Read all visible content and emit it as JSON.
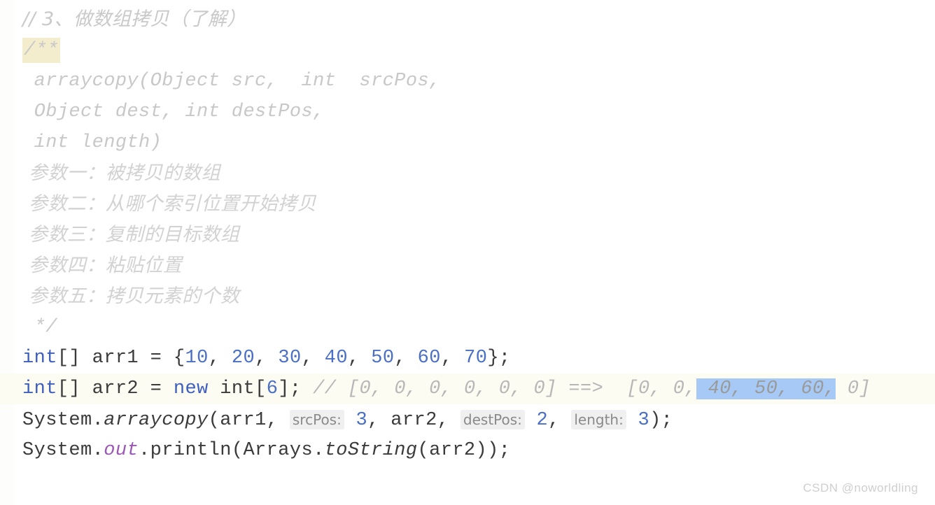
{
  "editor": {
    "background_color": "#ffffff",
    "current_line_color": "#fdfcf3",
    "selection_color": "#a6caf5",
    "find_highlight_color": "#f3eccd",
    "keyword_color": "#3f5fbf",
    "number_color": "#4a6fc4",
    "comment_color": "#c9c9c9",
    "static_field_color": "#9b59b6",
    "hint_background_color": "#f0f0f0"
  },
  "lines": {
    "l1": {
      "comment": "// 3、做数组拷贝（了解）"
    },
    "l2": {
      "javadoc_open": "/**"
    },
    "l3": {
      "text": " arraycopy(Object src,  int  srcPos,"
    },
    "l4": {
      "text": " Object dest, int destPos,"
    },
    "l5": {
      "text": " int length)"
    },
    "l6": {
      "text": " 参数一：被拷贝的数组"
    },
    "l7": {
      "text": " 参数二：从哪个索引位置开始拷贝"
    },
    "l8": {
      "text": " 参数三：复制的目标数组"
    },
    "l9": {
      "text": " 参数四：粘贴位置"
    },
    "l10": {
      "text": " 参数五：拷贝元素的个数"
    },
    "l11": {
      "javadoc_close": " */"
    },
    "l12": {
      "kw_int": "int",
      "brackets": "[] ",
      "var": "arr1",
      "eq": " = {",
      "n1": "10",
      "sep1": ", ",
      "n2": "20",
      "sep2": ", ",
      "n3": "30",
      "sep3": ", ",
      "n4": "40",
      "sep4": ", ",
      "n5": "50",
      "sep5": ", ",
      "n6": "60",
      "sep6": ", ",
      "n7": "70",
      "end": "};"
    },
    "l13": {
      "kw_int": "int",
      "brackets": "[] ",
      "var": "arr2",
      "eq": " = ",
      "kw_new": "new",
      "type": " int[",
      "size": "6",
      "tail": "]; ",
      "comment_pre": "// [0, 0, 0, 0, 0, 0] ==>  [0, 0,",
      "comment_selected": " 40, 50, 60,",
      "comment_post": " 0]"
    },
    "l14": {
      "receiver": "System.",
      "method": "arraycopy",
      "open": "(",
      "arg1": "arr1, ",
      "hint1": "srcPos:",
      "val1": "3",
      "comma1": ", ",
      "arg2": "arr2, ",
      "hint2": "destPos:",
      "val2": "2",
      "comma2": ", ",
      "hint3": "length:",
      "val3": "3",
      "close": ");"
    },
    "l15": {
      "receiver": "System.",
      "static_field": "out",
      "mid": ".println(Arrays.",
      "method": "toString",
      "tail": "(arr2));"
    }
  },
  "watermark": {
    "text": "CSDN @noworldling"
  }
}
